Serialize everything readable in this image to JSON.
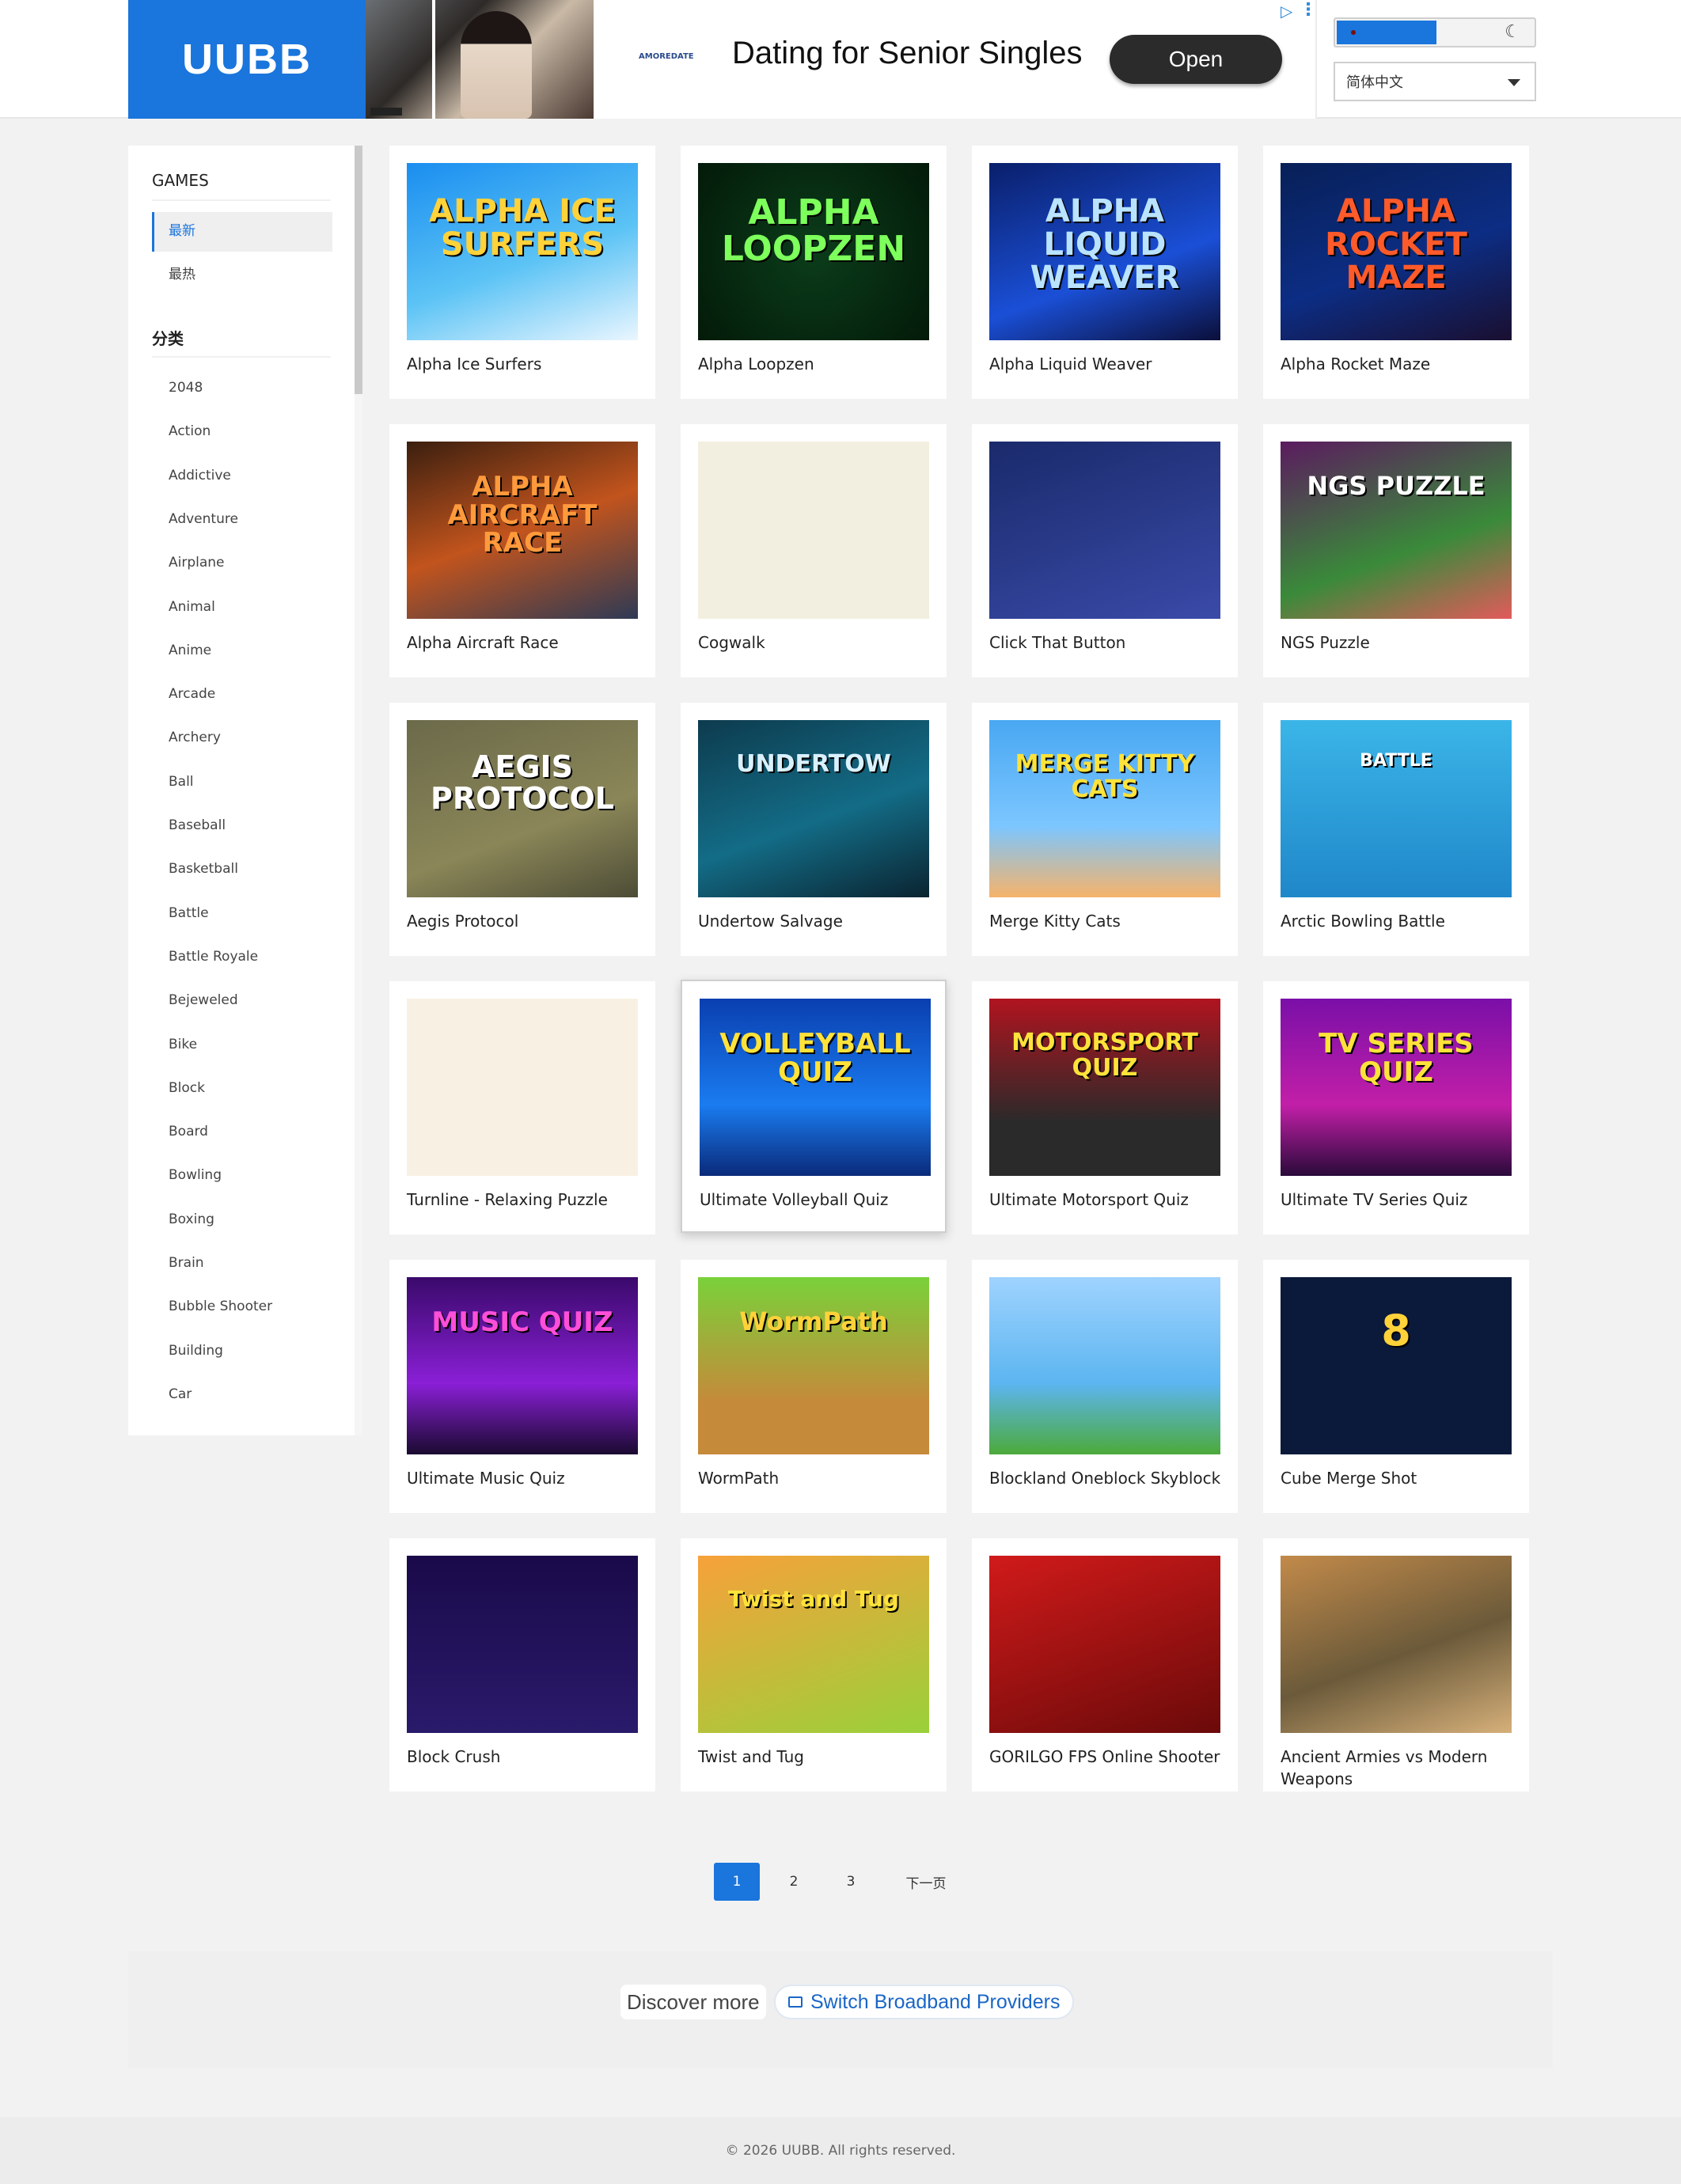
{
  "header": {
    "logo": "UUBB",
    "ad": {
      "title": "Dating for Senior Singles",
      "brand": "AMOREDATE",
      "cta": "Open"
    },
    "theme_toggle": {
      "moon_icon": "moon-icon"
    },
    "language": "简体中文"
  },
  "sidebar": {
    "games_heading": "GAMES",
    "sort_items": [
      "最新",
      "最热"
    ],
    "category_heading": "分类",
    "categories": [
      "2048",
      "Action",
      "Addictive",
      "Adventure",
      "Airplane",
      "Animal",
      "Anime",
      "Arcade",
      "Archery",
      "Ball",
      "Baseball",
      "Basketball",
      "Battle",
      "Battle Royale",
      "Bejeweled",
      "Bike",
      "Block",
      "Board",
      "Bowling",
      "Boxing",
      "Brain",
      "Bubble Shooter",
      "Building",
      "Car"
    ]
  },
  "games": [
    {
      "title": "Alpha Ice Surfers",
      "art": "ALPHA ICE SURFERS"
    },
    {
      "title": "Alpha Loopzen",
      "art": "ALPHA LOOPZEN"
    },
    {
      "title": "Alpha Liquid Weaver",
      "art": "ALPHA LIQUID WEAVER"
    },
    {
      "title": "Alpha Rocket Maze",
      "art": "ALPHA ROCKET MAZE"
    },
    {
      "title": "Alpha Aircraft Race",
      "art": "ALPHA AIRCRAFT RACE"
    },
    {
      "title": "Cogwalk",
      "art": ""
    },
    {
      "title": "Click That Button",
      "art": ""
    },
    {
      "title": "NGS Puzzle",
      "art": "NGS PUZZLE"
    },
    {
      "title": "Aegis Protocol",
      "art": "AEGIS PROTOCOL"
    },
    {
      "title": "Undertow Salvage",
      "art": "UNDERTOW"
    },
    {
      "title": "Merge Kitty Cats",
      "art": "MERGE KITTY CATS"
    },
    {
      "title": "Arctic Bowling Battle",
      "art": "BATTLE"
    },
    {
      "title": "Turnline - Relaxing Puzzle",
      "art": ""
    },
    {
      "title": "Ultimate Volleyball Quiz",
      "art": "VOLLEYBALL QUIZ"
    },
    {
      "title": "Ultimate Motorsport Quiz",
      "art": "MOTORSPORT QUIZ"
    },
    {
      "title": "Ultimate TV Series Quiz",
      "art": "TV SERIES QUIZ"
    },
    {
      "title": "Ultimate Music Quiz",
      "art": "MUSIC QUIZ"
    },
    {
      "title": "WormPath",
      "art": "WormPath"
    },
    {
      "title": "Blockland Oneblock Skyblock",
      "art": ""
    },
    {
      "title": "Cube Merge Shot",
      "art": "8"
    },
    {
      "title": "Block Crush",
      "art": ""
    },
    {
      "title": "Twist and Tug",
      "art": "Twist and Tug"
    },
    {
      "title": "GORILGO FPS Online Shooter",
      "art": ""
    },
    {
      "title": "Ancient Armies vs Modern Weapons",
      "art": ""
    }
  ],
  "pagination": {
    "pages": [
      "1",
      "2",
      "3"
    ],
    "next": "下一页",
    "current": "1"
  },
  "footer": {
    "discover_label": "Discover more",
    "discover_link": "Switch Broadband Providers",
    "copyright": "© 2026 UUBB. All rights reserved."
  },
  "colors": {
    "accent": "#1a75dc",
    "page_bg": "#f2f2f2"
  }
}
